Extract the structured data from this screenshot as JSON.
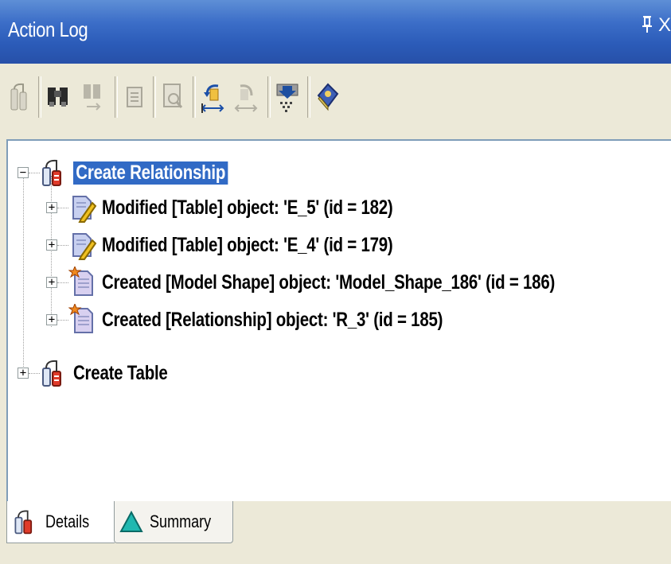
{
  "window": {
    "title": "Action Log",
    "pin_glyph": "ᚆ",
    "close_glyph": "X"
  },
  "toolbar": {
    "buttons": [
      {
        "icon": "undo-stack-icon",
        "enabled": false
      },
      {
        "icon": "binoculars-find-icon",
        "enabled": true
      },
      {
        "icon": "find-next-icon",
        "enabled": false
      },
      {
        "icon": "properties-icon",
        "enabled": false
      },
      {
        "icon": "preview-icon",
        "enabled": false
      },
      {
        "icon": "undo-icon",
        "enabled": true
      },
      {
        "icon": "redo-icon",
        "enabled": false
      },
      {
        "icon": "filter-icon",
        "enabled": true
      },
      {
        "icon": "help-book-icon",
        "enabled": true
      }
    ]
  },
  "tree": {
    "nodes": [
      {
        "label": "Create Relationship",
        "expanded": true,
        "selected": true,
        "level": 0,
        "icon": "transaction-icon"
      },
      {
        "label": "Modified [Table] object: 'E_5' (id = 182)",
        "expanded": false,
        "level": 1,
        "icon": "modified-object-icon"
      },
      {
        "label": "Modified [Table] object: 'E_4' (id = 179)",
        "expanded": false,
        "level": 1,
        "icon": "modified-object-icon"
      },
      {
        "label": "Created [Model Shape] object: 'Model_Shape_186' (id = 186)",
        "expanded": false,
        "level": 1,
        "icon": "created-object-icon"
      },
      {
        "label": "Created [Relationship] object: 'R_3' (id = 185)",
        "expanded": false,
        "level": 1,
        "icon": "created-object-icon"
      },
      {
        "label": "Create Table",
        "expanded": false,
        "level": 0,
        "icon": "transaction-icon"
      }
    ]
  },
  "tabs": [
    {
      "label": "Details",
      "active": true,
      "icon": "transaction-icon"
    },
    {
      "label": "Summary",
      "active": false,
      "icon": "triangle-icon"
    }
  ],
  "colors": {
    "titlebar": "#2b5bb8",
    "selection": "#316ac5",
    "panel": "#ece9d8"
  }
}
